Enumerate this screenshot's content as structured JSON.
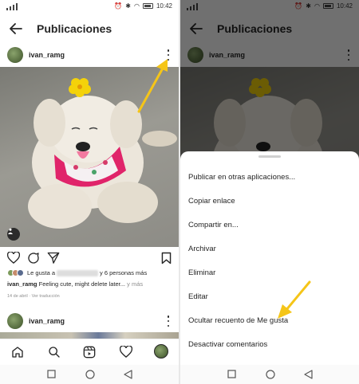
{
  "statusbar": {
    "time": "10:42",
    "battery": ""
  },
  "header": {
    "title": "Publicaciones"
  },
  "post": {
    "username": "ivan_ramg",
    "likes_prefix": "Le gusta a",
    "likes_suffix": "y 6 personas más",
    "caption_user": "ivan_ramg",
    "caption_text": "Feeling cute, might delete later...",
    "caption_more": "y más",
    "date": "14 de abril",
    "translation": "Ver traducción"
  },
  "next_post": {
    "username": "ivan_ramg"
  },
  "menu": {
    "items": [
      "Publicar en otras aplicaciones...",
      "Copiar enlace",
      "Compartir en...",
      "Archivar",
      "Eliminar",
      "Editar",
      "Ocultar recuento de Me gusta",
      "Desactivar comentarios"
    ]
  },
  "icons": {
    "back": "arrow-left-icon",
    "more": "more-vertical-icon",
    "info": "info-icon",
    "like": "heart-icon",
    "comment": "comment-icon",
    "share": "send-icon",
    "save": "bookmark-icon",
    "home": "home-icon",
    "search": "search-icon",
    "reels": "reels-icon",
    "activity": "heart-icon",
    "profile": "avatar",
    "sys_back": "triangle-icon",
    "sys_home": "circle-icon",
    "sys_recent": "square-icon"
  },
  "colors": {
    "annotation_arrow": "#f5c518",
    "text": "#262626",
    "muted": "#8e8e8e",
    "overlay": "rgba(0,0,0,0.56)"
  }
}
